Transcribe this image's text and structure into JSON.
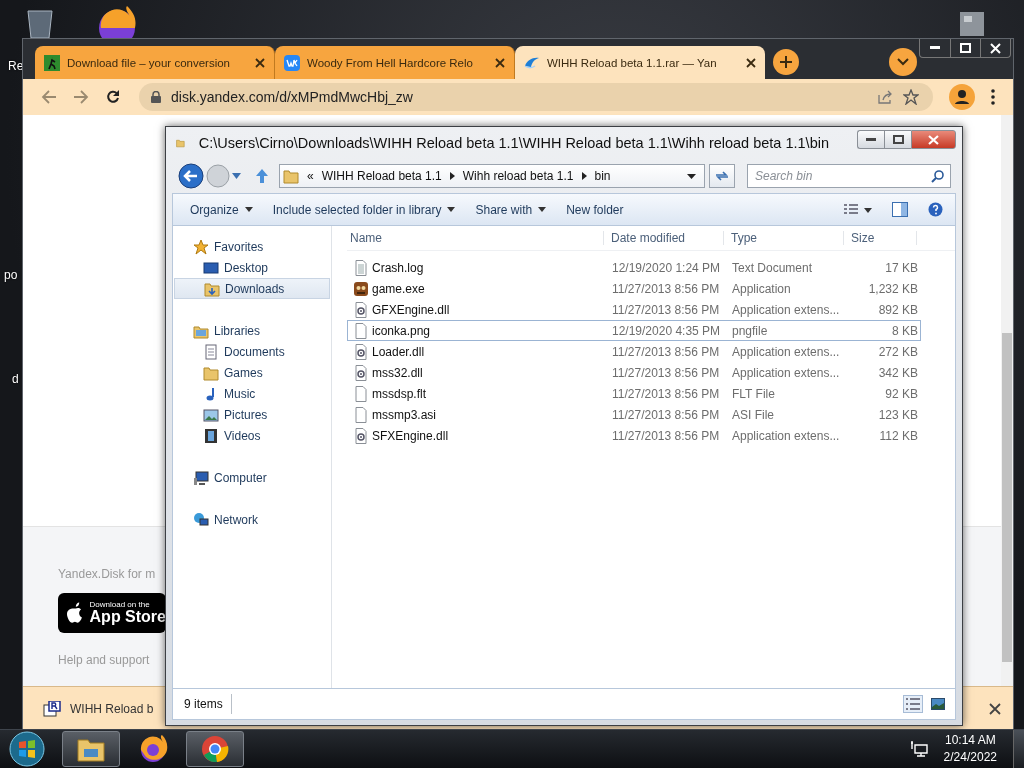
{
  "desktop": {
    "labels": [
      "Re",
      "po",
      "d"
    ]
  },
  "browser": {
    "tabs": [
      {
        "kind": "converter",
        "title": "Download file – your conversion",
        "selected": false
      },
      {
        "kind": "vk",
        "title": "Woody From Hell Hardcore Relo",
        "selected": false
      },
      {
        "kind": "disk",
        "title": "WIHH Reload beta 1.1.rar — Yan",
        "selected": true
      }
    ],
    "url": "disk.yandex.com/d/xMPmdMwcHbj_zw",
    "page": {
      "promo": "Yandex.Disk for m",
      "store_badge": {
        "small": "Download on the",
        "large": "App Store"
      },
      "help_link": "Help and support"
    },
    "download_bar": {
      "file": "WIHH Reload b"
    }
  },
  "explorer": {
    "title": "C:\\Users\\Cirno\\Downloads\\WIHH Reload beta 1.1\\WIHH Reload beta 1.1\\Wihh reload beta 1.1\\bin",
    "breadcrumb": {
      "overflow": "«",
      "parts": [
        "WIHH Reload beta 1.1",
        "Wihh reload beta 1.1",
        "bin"
      ]
    },
    "search_placeholder": "Search bin",
    "commands": [
      {
        "label": "Organize",
        "menu": true
      },
      {
        "label": "Include selected folder in library",
        "menu": true
      },
      {
        "label": "Share with",
        "menu": true
      },
      {
        "label": "New folder",
        "menu": false
      }
    ],
    "nav": [
      {
        "kind": "favorites",
        "label": "Favorites",
        "selected": false,
        "children": [
          {
            "kind": "desktop",
            "label": "Desktop",
            "selected": false
          },
          {
            "kind": "downloads",
            "label": "Downloads",
            "selected": true
          }
        ]
      },
      {
        "kind": "libraries",
        "label": "Libraries",
        "selected": false,
        "children": [
          {
            "kind": "documents",
            "label": "Documents",
            "selected": false
          },
          {
            "kind": "folder",
            "label": "Games",
            "selected": false
          },
          {
            "kind": "music",
            "label": "Music",
            "selected": false
          },
          {
            "kind": "pictures",
            "label": "Pictures",
            "selected": false
          },
          {
            "kind": "videos",
            "label": "Videos",
            "selected": false
          }
        ]
      },
      {
        "kind": "computer",
        "label": "Computer",
        "selected": false
      },
      {
        "kind": "network",
        "label": "Network",
        "selected": false
      }
    ],
    "columns": [
      "Name",
      "Date modified",
      "Type",
      "Size"
    ],
    "files": [
      {
        "kind": "text",
        "name": "Crash.log",
        "date": "12/19/2020 1:24 PM",
        "type": "Text Document",
        "size": "17 KB",
        "focused": false
      },
      {
        "kind": "app",
        "name": "game.exe",
        "date": "11/27/2013 8:56 PM",
        "type": "Application",
        "size": "1,232 KB",
        "focused": false
      },
      {
        "kind": "dll",
        "name": "GFXEngine.dll",
        "date": "11/27/2013 8:56 PM",
        "type": "Application extens...",
        "size": "892 KB",
        "focused": false
      },
      {
        "kind": "blank",
        "name": "iconka.png",
        "date": "12/19/2020 4:35 PM",
        "type": "pngfile",
        "size": "8 KB",
        "focused": true
      },
      {
        "kind": "dll",
        "name": "Loader.dll",
        "date": "11/27/2013 8:56 PM",
        "type": "Application extens...",
        "size": "272 KB",
        "focused": false
      },
      {
        "kind": "dll",
        "name": "mss32.dll",
        "date": "11/27/2013 8:56 PM",
        "type": "Application extens...",
        "size": "342 KB",
        "focused": false
      },
      {
        "kind": "blank",
        "name": "mssdsp.flt",
        "date": "11/27/2013 8:56 PM",
        "type": "FLT File",
        "size": "92 KB",
        "focused": false
      },
      {
        "kind": "blank",
        "name": "mssmp3.asi",
        "date": "11/27/2013 8:56 PM",
        "type": "ASI File",
        "size": "123 KB",
        "focused": false
      },
      {
        "kind": "dll",
        "name": "SFXEngine.dll",
        "date": "11/27/2013 8:56 PM",
        "type": "Application extens...",
        "size": "112 KB",
        "focused": false
      }
    ],
    "status": "9 items"
  },
  "taskbar": {
    "apps": [
      {
        "kind": "explorer",
        "running": true
      },
      {
        "kind": "firefox",
        "running": false
      },
      {
        "kind": "chrome",
        "running": true
      }
    ],
    "time": "10:14 AM",
    "date": "2/24/2022"
  }
}
